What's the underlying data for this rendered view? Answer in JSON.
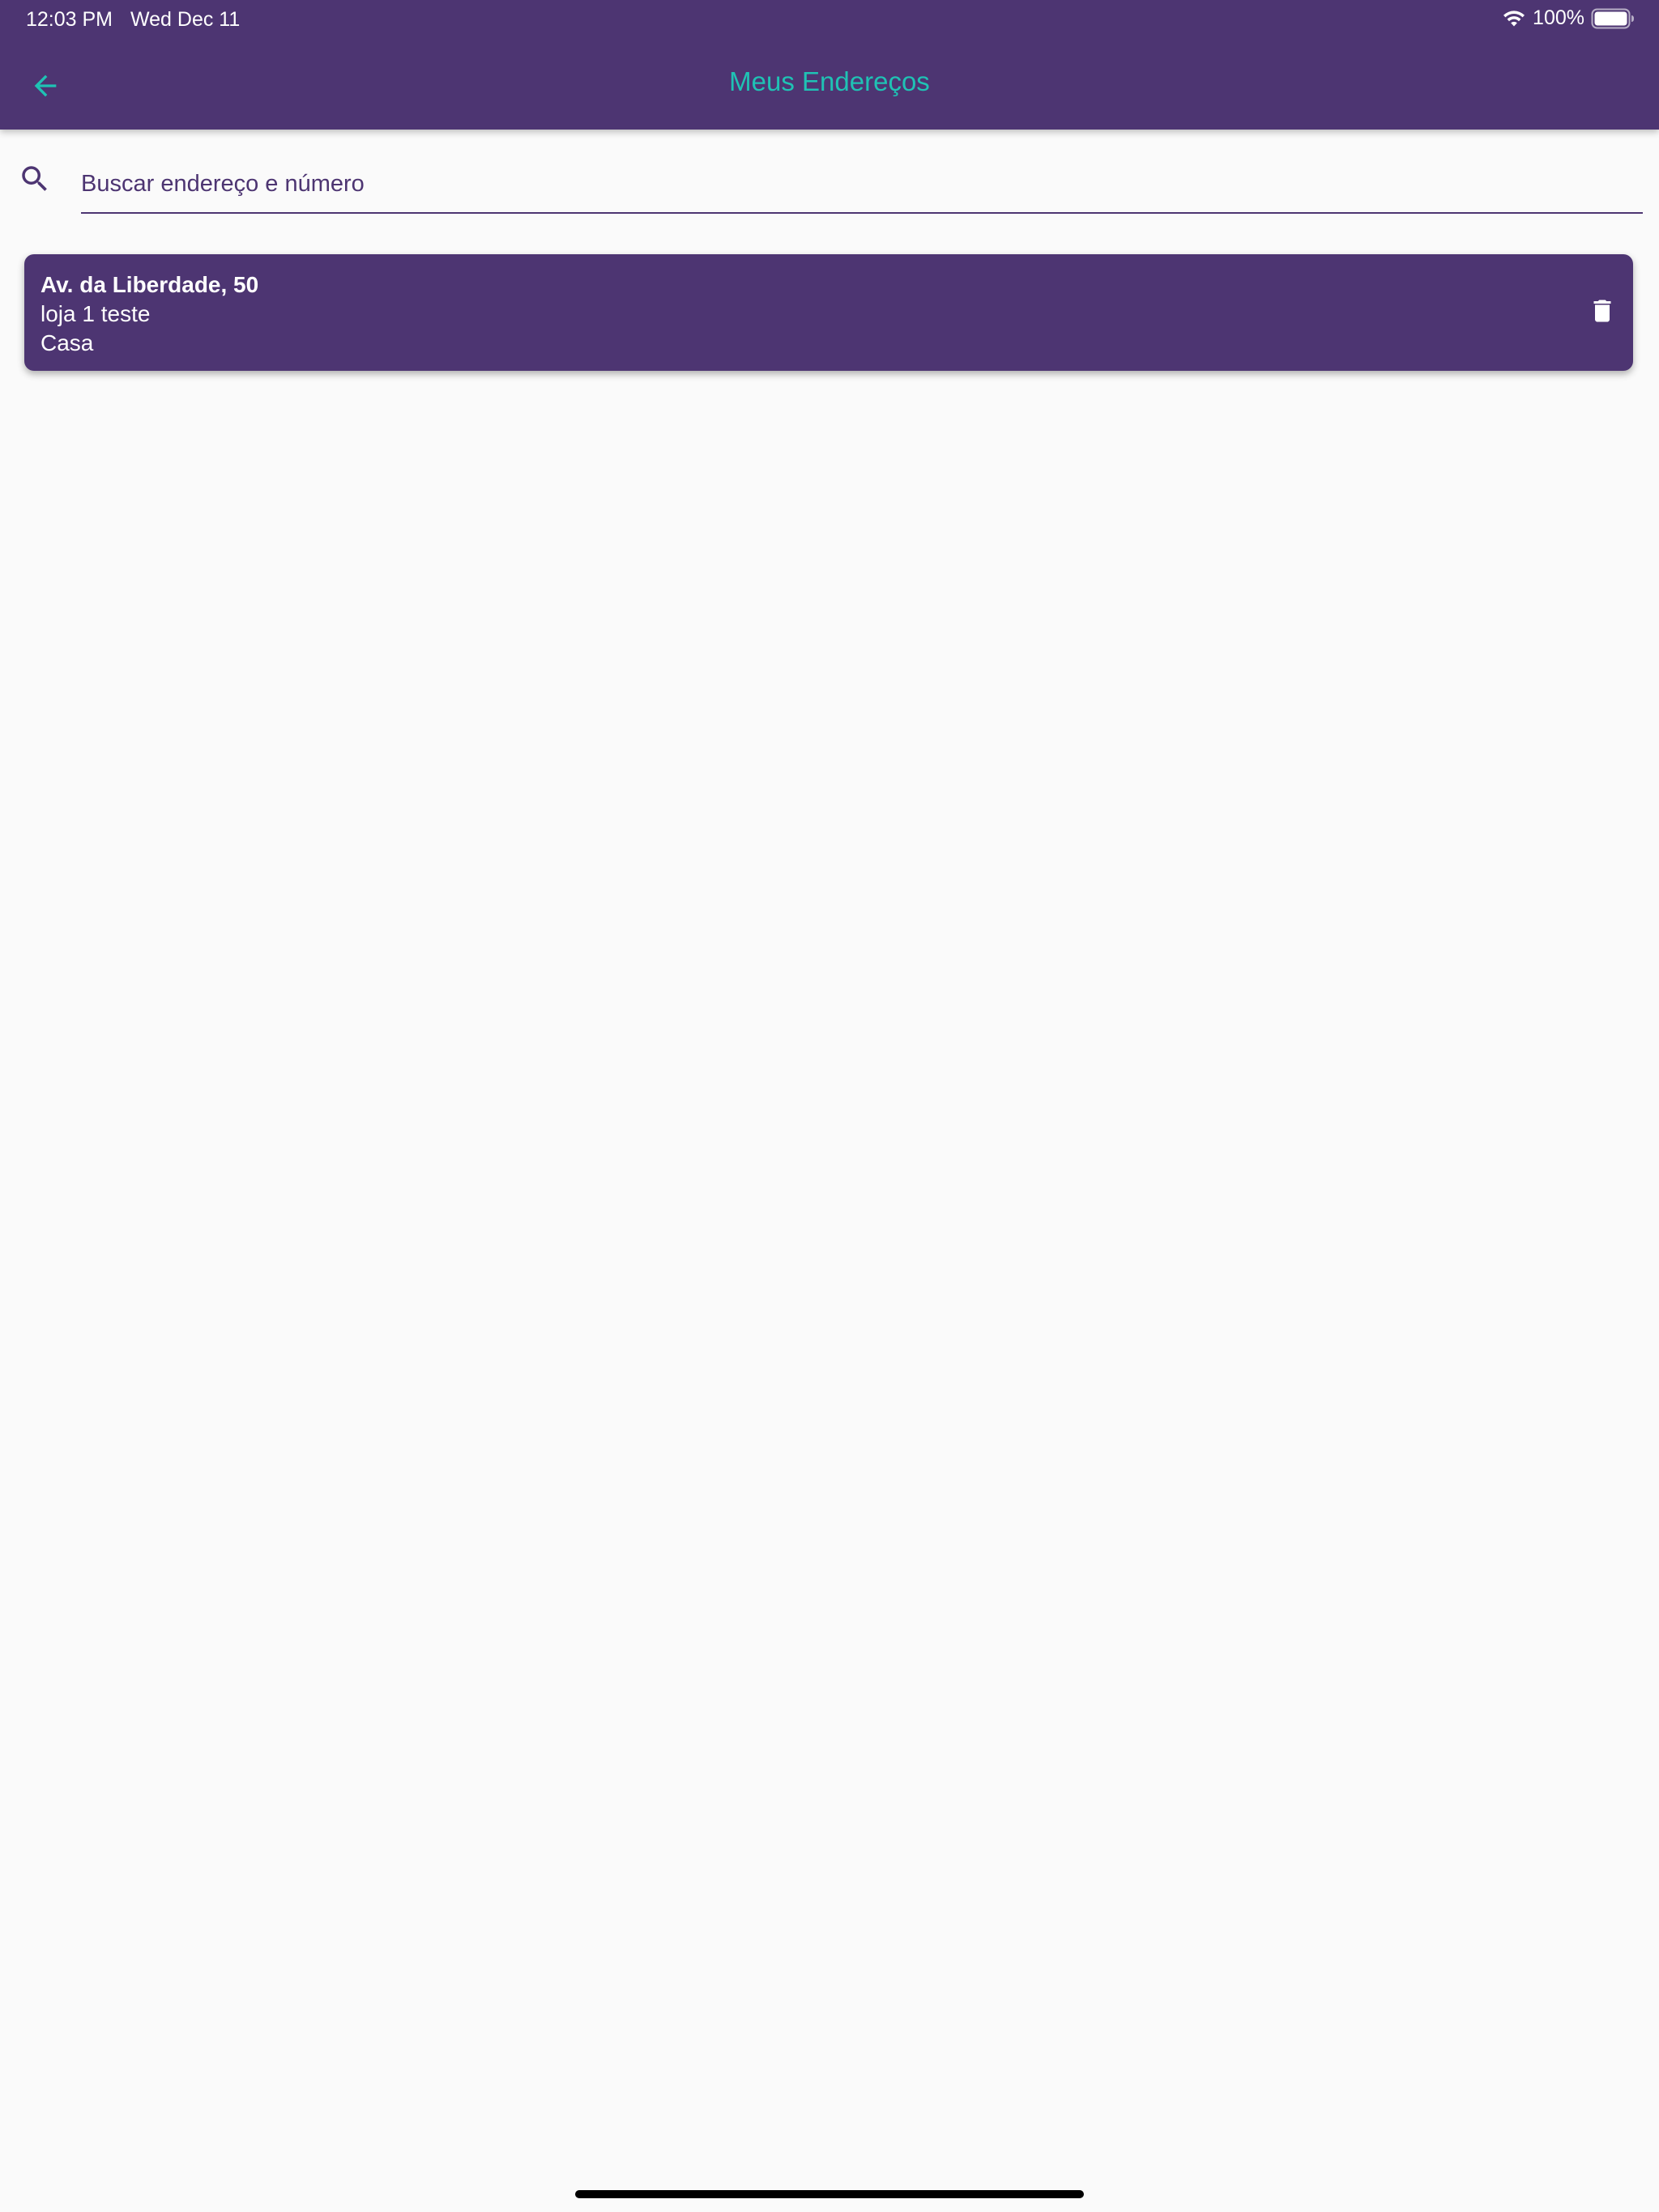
{
  "status_bar": {
    "time": "12:03 PM",
    "date": "Wed Dec 11",
    "battery": "100%"
  },
  "header": {
    "title": "Meus Endereços",
    "back_icon": "arrow-left-icon"
  },
  "search": {
    "placeholder": "Buscar endereço e número",
    "icon": "search-icon"
  },
  "addresses": [
    {
      "street": "Av. da Liberdade, 50",
      "complement": "loja 1 teste",
      "label": "Casa",
      "delete_icon": "trash-icon"
    }
  ],
  "colors": {
    "primary": "#4d3572",
    "accent": "#1fc2b4",
    "background": "#fafafa",
    "on_primary": "#ffffff"
  }
}
